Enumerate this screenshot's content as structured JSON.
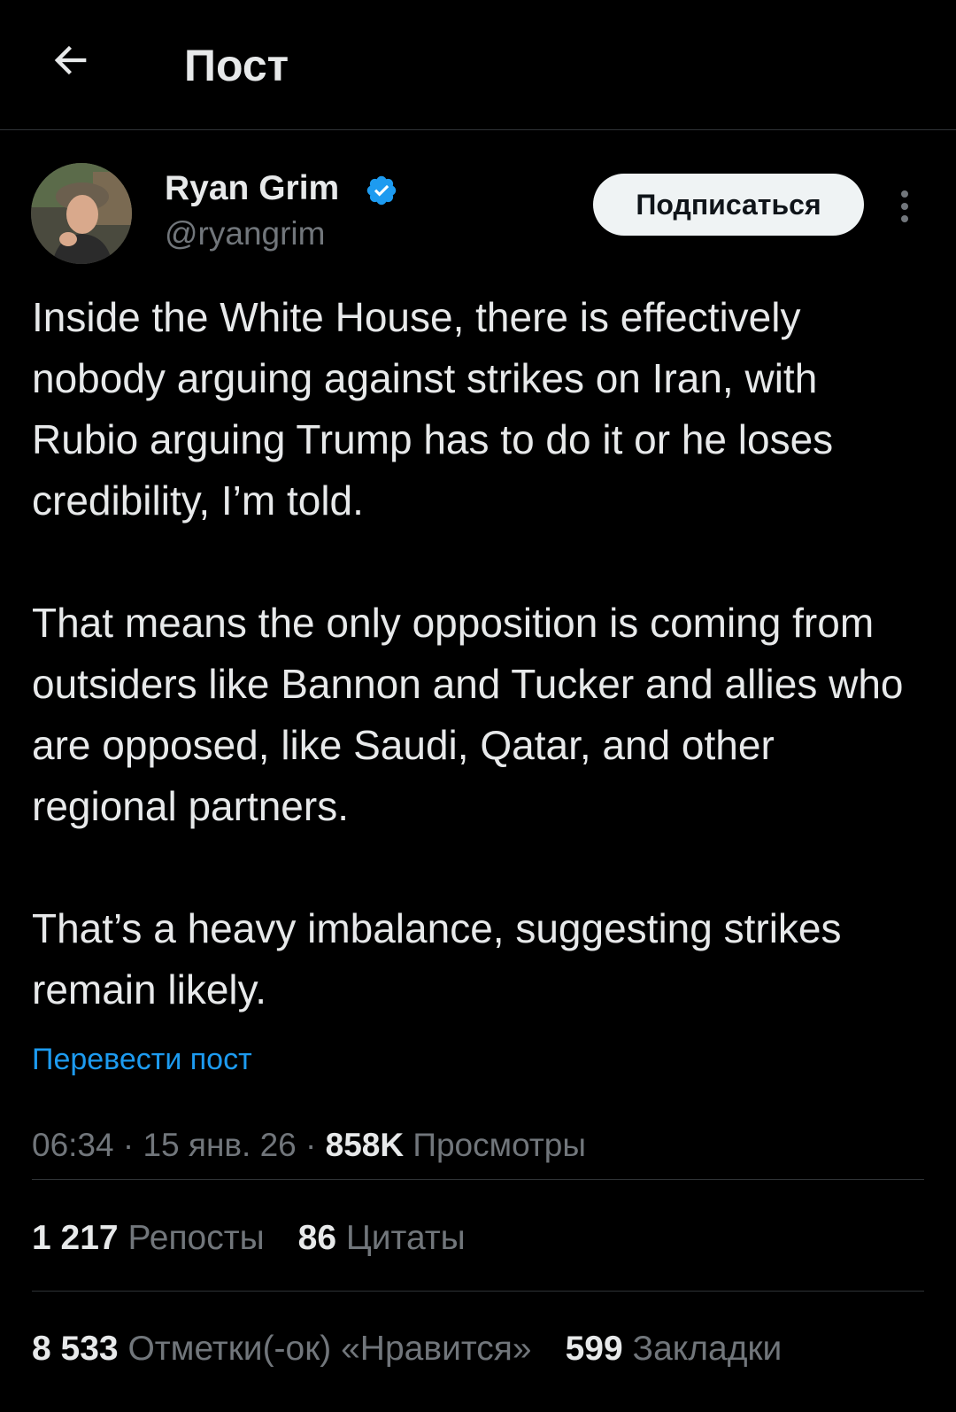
{
  "header": {
    "title": "Пост",
    "back_icon": "arrow-left-icon"
  },
  "author": {
    "name": "Ryan Grim",
    "handle": "@ryangrim",
    "verified_icon": "verified-badge-icon",
    "verified_color": "#1d9bf0"
  },
  "actions": {
    "follow_label": "Подписаться",
    "more_icon": "more-vertical-icon"
  },
  "post": {
    "paragraphs": [
      "Inside the White House, there is effectively nobody arguing against strikes on Iran, with Rubio arguing Trump has to do it or he loses credibility, I’m told.",
      "That means the only opposition is coming from outsiders like Bannon and Tucker and allies who are opposed, like Saudi, Qatar, and other regional partners.",
      "That’s a heavy imbalance, suggesting strikes remain likely."
    ],
    "translate_label": "Перевести пост"
  },
  "meta": {
    "time": "06:34",
    "separator": "·",
    "date": "15 янв. 26",
    "views_count": "858K",
    "views_label": "Просмотры"
  },
  "stats": {
    "reposts": {
      "count": "1 217",
      "label": "Репосты"
    },
    "quotes": {
      "count": "86",
      "label": "Цитаты"
    },
    "likes": {
      "count": "8 533",
      "label": "Отметки(-ок) «Нравится»"
    },
    "bookmarks": {
      "count": "599",
      "label": "Закладки"
    }
  },
  "colors": {
    "background": "#000000",
    "text_primary": "#e7e9ea",
    "text_secondary": "#71767b",
    "accent": "#1d9bf0",
    "divider": "#2f3336",
    "button_bg": "#eff3f4"
  }
}
